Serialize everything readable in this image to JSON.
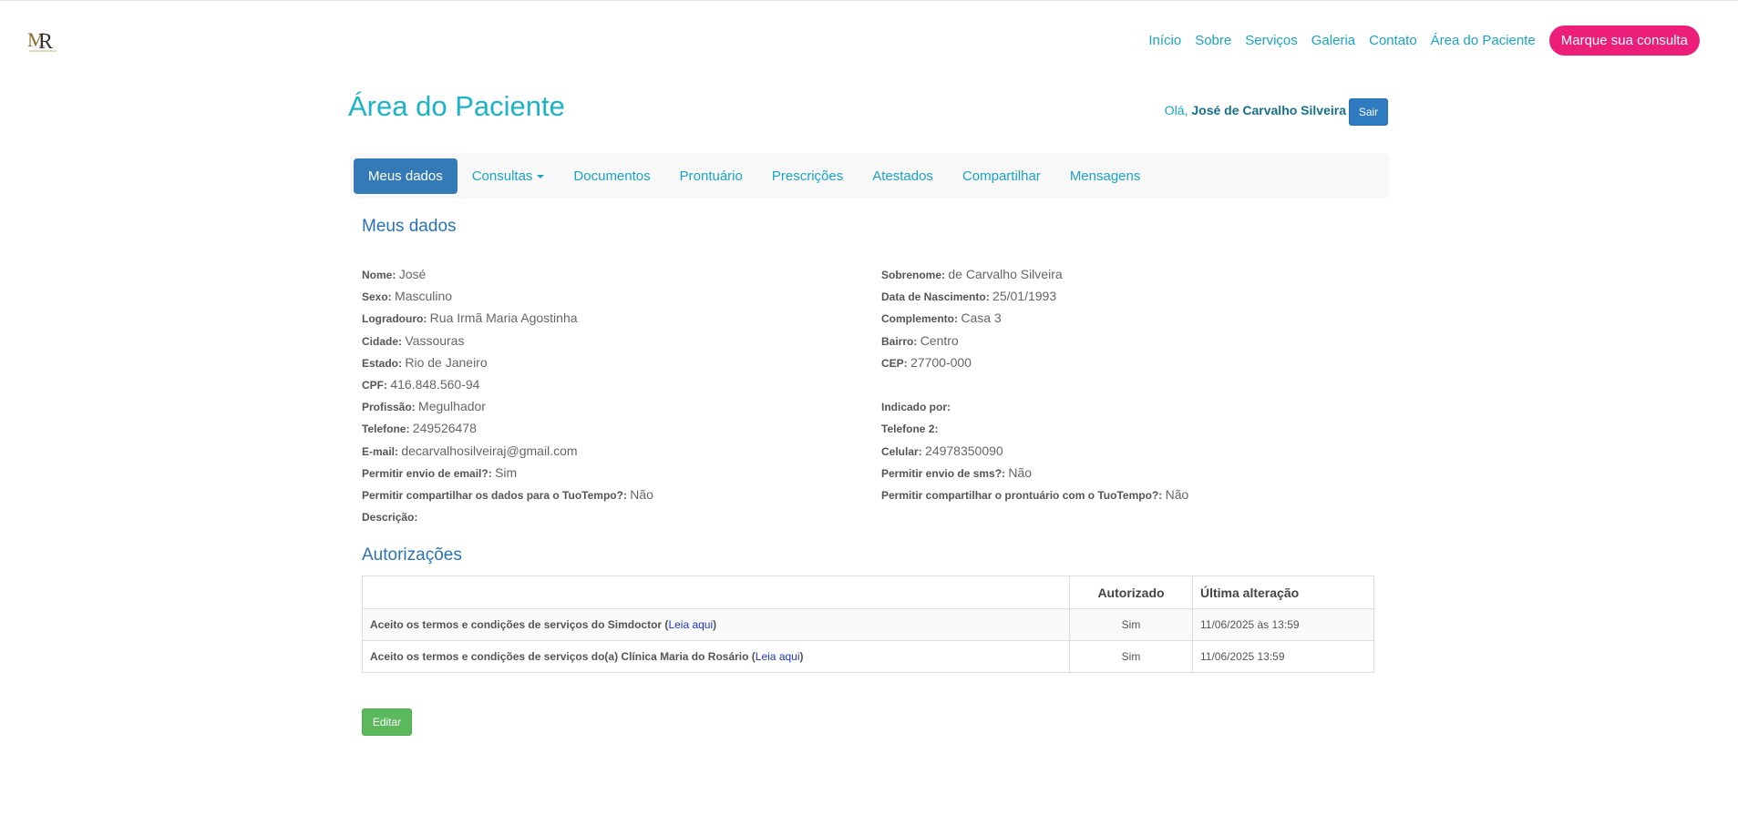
{
  "brand": {
    "logo_text": "MR",
    "accent": "#1ab3c8",
    "cta_color": "#ec1e79"
  },
  "nav": {
    "items": [
      "Início",
      "Sobre",
      "Serviços",
      "Galeria",
      "Contato",
      "Área do Paciente"
    ],
    "cta": "Marque sua consulta"
  },
  "page": {
    "title": "Área do Paciente",
    "greeting_prefix": "Olá,",
    "user_name": "José de Carvalho Silveira",
    "logout": "Sair"
  },
  "tabs": [
    {
      "label": "Meus dados",
      "active": true
    },
    {
      "label": "Consultas",
      "dropdown": true
    },
    {
      "label": "Documentos"
    },
    {
      "label": "Prontuário"
    },
    {
      "label": "Prescrições"
    },
    {
      "label": "Atestados"
    },
    {
      "label": "Compartilhar"
    },
    {
      "label": "Mensagens"
    }
  ],
  "personal": {
    "title": "Meus dados",
    "left": [
      {
        "label": "Nome:",
        "value": "José"
      },
      {
        "label": "Sexo:",
        "value": "Masculino"
      },
      {
        "label": "Logradouro:",
        "value": "Rua Irmã Maria Agostinha"
      },
      {
        "label": "Cidade:",
        "value": "Vassouras"
      },
      {
        "label": "Estado:",
        "value": "Rio de Janeiro"
      },
      {
        "label": "CPF:",
        "value": "416.848.560-94"
      },
      {
        "label": "Profissão:",
        "value": "Megulhador"
      },
      {
        "label": "Telefone:",
        "value": "249526478"
      },
      {
        "label": "E-mail:",
        "value": "decarvalhosilveiraj@gmail.com"
      },
      {
        "label": "Permitir envio de email?:",
        "value": "Sim"
      },
      {
        "label": "Permitir compartilhar os dados para o TuoTempo?:",
        "value": "Não"
      },
      {
        "label": "Descrição:",
        "value": ""
      }
    ],
    "right": [
      {
        "label": "Sobrenome:",
        "value": "de Carvalho Silveira"
      },
      {
        "label": "Data de Nascimento:",
        "value": "25/01/1993"
      },
      {
        "label": "Complemento:",
        "value": "Casa 3"
      },
      {
        "label": "Bairro:",
        "value": "Centro"
      },
      {
        "label": "CEP:",
        "value": "27700-000"
      },
      {
        "label": "",
        "value": ""
      },
      {
        "label": "Indicado por:",
        "value": ""
      },
      {
        "label": "Telefone 2:",
        "value": ""
      },
      {
        "label": "Celular:",
        "value": "24978350090"
      },
      {
        "label": "Permitir envio de sms?:",
        "value": "Não"
      },
      {
        "label": "Permitir compartilhar o prontuário com o TuoTempo?:",
        "value": "Não"
      }
    ]
  },
  "authorizations": {
    "title": "Autorizações",
    "columns": [
      "",
      "Autorizado",
      "Última alteração"
    ],
    "rows": [
      {
        "term": "Aceito os termos e condições de serviços do Simdoctor",
        "link": "Leia aqui",
        "authorized": "Sim",
        "updated": "11/06/2025 às 13:59"
      },
      {
        "term": "Aceito os termos e condições de serviços do(a) Clínica Maria do Rosário",
        "link": "Leia aqui",
        "authorized": "Sim",
        "updated": "11/06/2025 13:59"
      }
    ]
  },
  "actions": {
    "edit": "Editar"
  }
}
